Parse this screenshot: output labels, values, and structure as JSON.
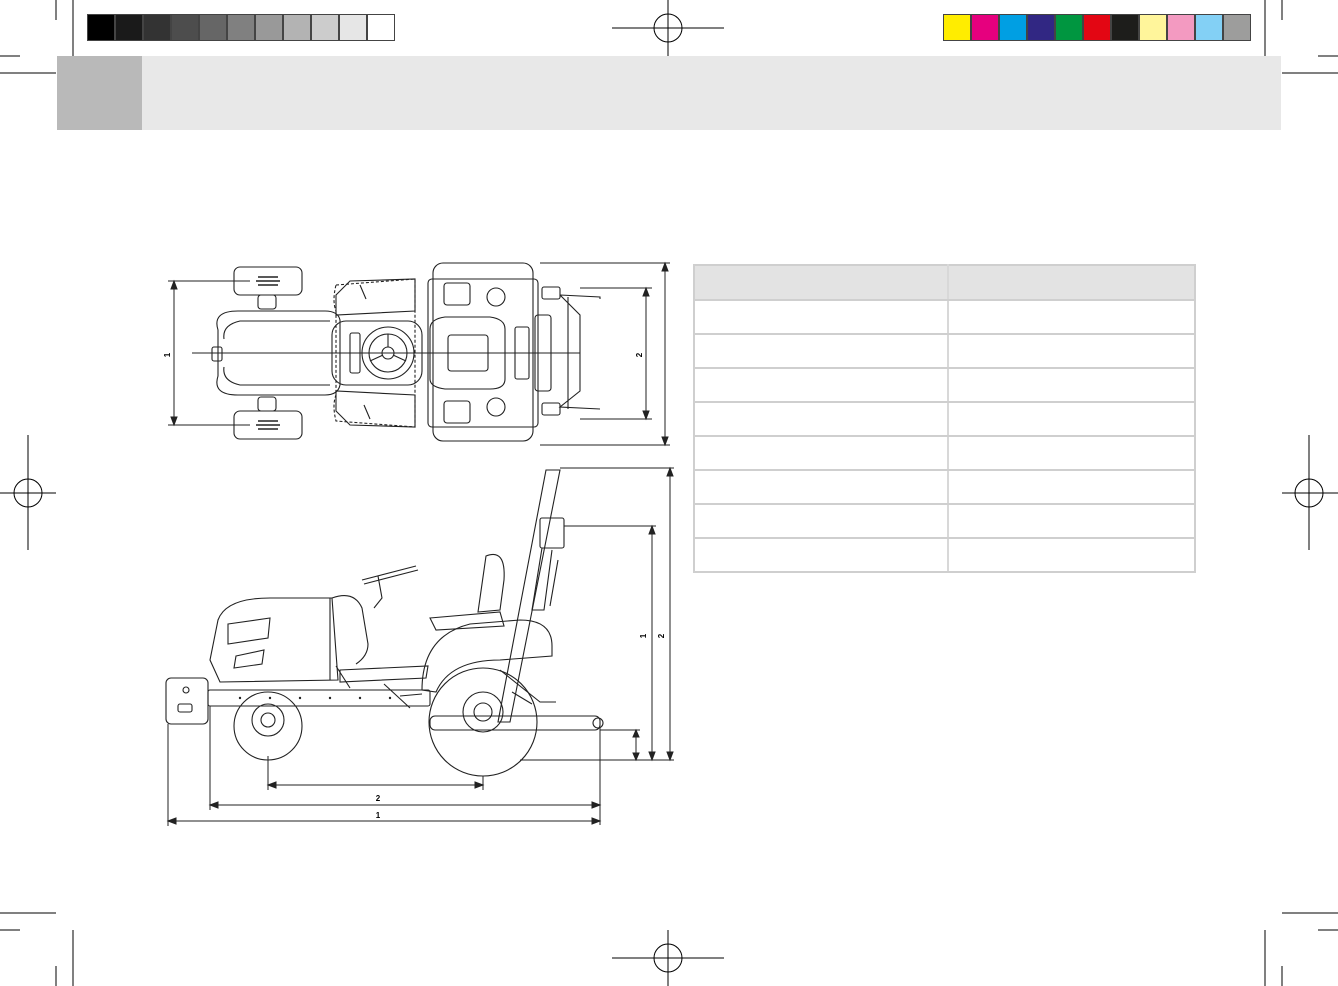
{
  "print_marks": {
    "grayscale_swatches": [
      "#000000",
      "#1a1a1a",
      "#333333",
      "#4d4d4d",
      "#666666",
      "#808080",
      "#999999",
      "#b3b3b3",
      "#cccccc",
      "#e6e6e6",
      "#ffffff"
    ],
    "color_swatches": [
      "#ffed00",
      "#e6007e",
      "#009fe3",
      "#312783",
      "#009640",
      "#e30613",
      "#1d1d1b",
      "#fff59b",
      "#f39ac1",
      "#83d0f5",
      "#9d9d9c"
    ]
  },
  "header": {
    "accent_color": "#b9b9b9",
    "band_color": "#e8e8e8"
  },
  "top_view": {
    "dim_1": "1",
    "dim_2": "2"
  },
  "side_view": {
    "height_dim_1": "1",
    "height_dim_2": "2",
    "length_dim_2": "2",
    "length_dim_1": "1"
  },
  "spec_table": {
    "header": [
      "",
      ""
    ],
    "rows": [
      [
        "",
        ""
      ],
      [
        "",
        ""
      ],
      [
        "",
        ""
      ],
      [
        "",
        ""
      ],
      [
        "",
        ""
      ],
      [
        "",
        ""
      ],
      [
        "",
        ""
      ],
      [
        "",
        ""
      ]
    ]
  }
}
